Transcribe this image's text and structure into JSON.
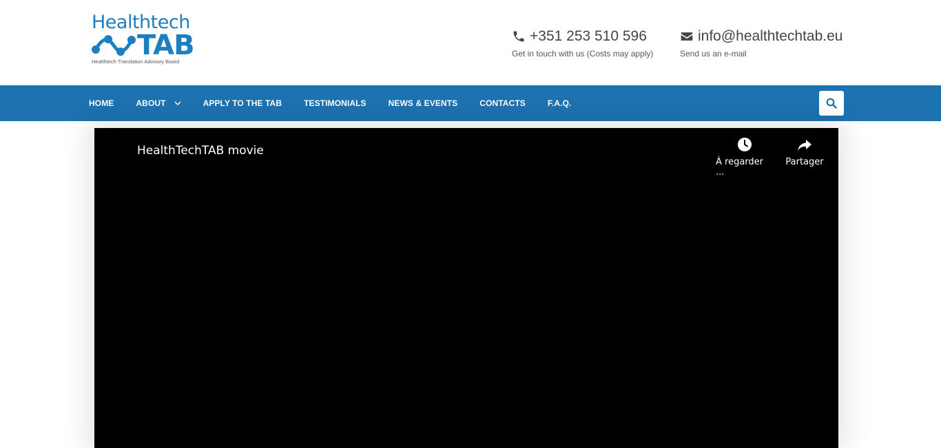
{
  "logo": {
    "word1": "Healthtech",
    "word2": "TAB",
    "tagline": "Healthtech Translation Advisory Board",
    "color": "#1d7fc0"
  },
  "contact": {
    "phone": {
      "icon": "phone-icon",
      "value": "+351 253 510 596",
      "sub": "Get in touch with us (Costs may apply)"
    },
    "email": {
      "icon": "envelope-icon",
      "value": "info@healthtechtab.eu",
      "sub": "Send us an e-mail"
    }
  },
  "nav": {
    "background": "#1d72b0",
    "items": [
      {
        "label": "HOME"
      },
      {
        "label": "ABOUT",
        "has_dropdown": true
      },
      {
        "label": "APPLY TO THE TAB"
      },
      {
        "label": "TESTIMONIALS"
      },
      {
        "label": "NEWS & EVENTS"
      },
      {
        "label": "CONTACTS"
      },
      {
        "label": "F.A.Q."
      }
    ],
    "search_icon": "search-icon"
  },
  "video": {
    "title": "HealthTechTAB movie",
    "watch_later": "À regarder ...",
    "share": "Partager"
  }
}
